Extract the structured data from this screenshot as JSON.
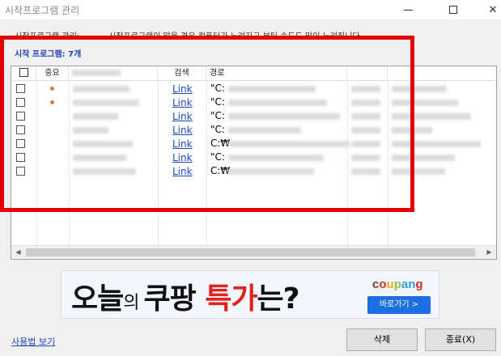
{
  "window": {
    "title": "시작프로그램 관리",
    "minimize_icon": "minimize-icon",
    "maximize_icon": "maximize-icon",
    "close_icon": "close-icon"
  },
  "description": {
    "label": "시작프로그램 관리:",
    "text": "시작프로그램이 많을 경우 컴퓨터가 느려지고 부팅 속도도 많이 느려집니다"
  },
  "startup_count": "시작 프로그램: 7개",
  "table": {
    "columns": [
      "",
      "중요",
      "",
      "검색",
      "경로",
      "",
      ""
    ],
    "rows": [
      {
        "important": true,
        "search": "Link",
        "path": "\"C:"
      },
      {
        "important": true,
        "search": "Link",
        "path": "\"C:"
      },
      {
        "important": false,
        "search": "Link",
        "path": "\"C:"
      },
      {
        "important": false,
        "search": "Link",
        "path": "\"C:"
      },
      {
        "important": false,
        "search": "Link",
        "path": "C:₩"
      },
      {
        "important": false,
        "search": "Link",
        "path": "\"C:"
      },
      {
        "important": false,
        "search": "Link",
        "path": "C:₩"
      }
    ]
  },
  "ad": {
    "part1": "오늘",
    "part2": "의 ",
    "part3": "쿠팡 ",
    "part4": "특가",
    "part5": "는?",
    "brand_letters": [
      {
        "ch": "c",
        "color": "#7b3f1f"
      },
      {
        "ch": "o",
        "color": "#e02a2a"
      },
      {
        "ch": "u",
        "color": "#f2a81c"
      },
      {
        "ch": "p",
        "color": "#8cc63f"
      },
      {
        "ch": "a",
        "color": "#2f9fd8"
      },
      {
        "ch": "n",
        "color": "#2f9fd8"
      },
      {
        "ch": "g",
        "color": "#e02a2a"
      }
    ],
    "cta": "바로가기 >"
  },
  "footer": {
    "usage_link": "사용법 보기",
    "delete_button": "삭제",
    "close_button": "종료(X)"
  },
  "colors": {
    "highlight": "#e50000",
    "link": "#1b48c8",
    "count_text": "#1a3fbf",
    "important_dot": "#e8762c"
  }
}
